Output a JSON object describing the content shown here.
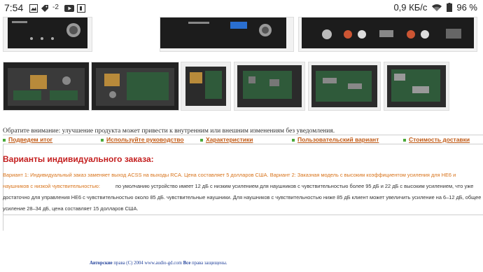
{
  "statusbar": {
    "time": "7:54",
    "badge_count": "-2",
    "net_speed": "0,9 КБ/с",
    "battery": "96 %"
  },
  "notice": "Обратите внимание: улучшение продукта может привести к внутренним или внешним изменениям без уведомления.",
  "nav": [
    {
      "label": "Подведем итог"
    },
    {
      "label": "Используйте руководство"
    },
    {
      "label": "Характеристики"
    },
    {
      "label": "Пользовательский вариант"
    },
    {
      "label": "Стоимость доставки"
    }
  ],
  "heading": "Варианты индивидуального заказа:",
  "variants_orange": "Вариант 1: Индивидуальный заказ заменяет выход ACSS на выходы RCA. Цена составляет 5 долларов США. Вариант 2: Заказная модель с высоким коэффициентом усиления для HE6 и наушников с низкой чувствительностью:",
  "variants_rest": "по умолчанию устройство имеет 12 дБ с низким усилением для наушников с чувствительностью более 95 дБ и 22 дБ с высоким усилением, что уже достаточно для управления HE6 с чувствительностью около 85 дБ. чувствительные наушники. Для наушников с чувствительностью ниже 85 дБ клиент может увеличить усиление на 6–12 дБ, общее усиление 28–34 дБ, цена составляет 15 долларов США.",
  "footer": {
    "part1": "Авторские",
    "part2": "права (C) 2004 www.audio-gd.com",
    "part3": "Все",
    "part4": "права защищены."
  },
  "icons": [
    "image-icon",
    "tag-icon",
    "youtube-icon",
    "app-icon",
    "wifi-icon",
    "battery-icon"
  ]
}
